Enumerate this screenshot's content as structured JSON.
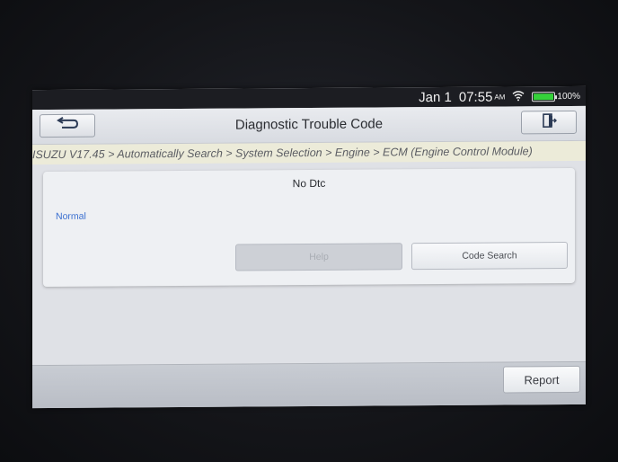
{
  "statusbar": {
    "date": "Jan 1",
    "time": "07:55",
    "ampm": "AM",
    "battery_pct": "100%",
    "battery_level": 1.0,
    "battery_color": "#35d13a",
    "wifi_icon": "wifi-icon"
  },
  "header": {
    "title": "Diagnostic Trouble Code",
    "back_icon": "back-arrow-icon",
    "exit_icon": "exit-icon"
  },
  "breadcrumb": "ISUZU V17.45 > Automatically Search > System Selection > Engine > ECM (Engine Control Module)",
  "panel": {
    "heading": "No Dtc",
    "status": "Normal",
    "status_color": "#3a6fd0",
    "help_label": "Help",
    "code_search_label": "Code Search"
  },
  "footer": {
    "report_label": "Report"
  }
}
